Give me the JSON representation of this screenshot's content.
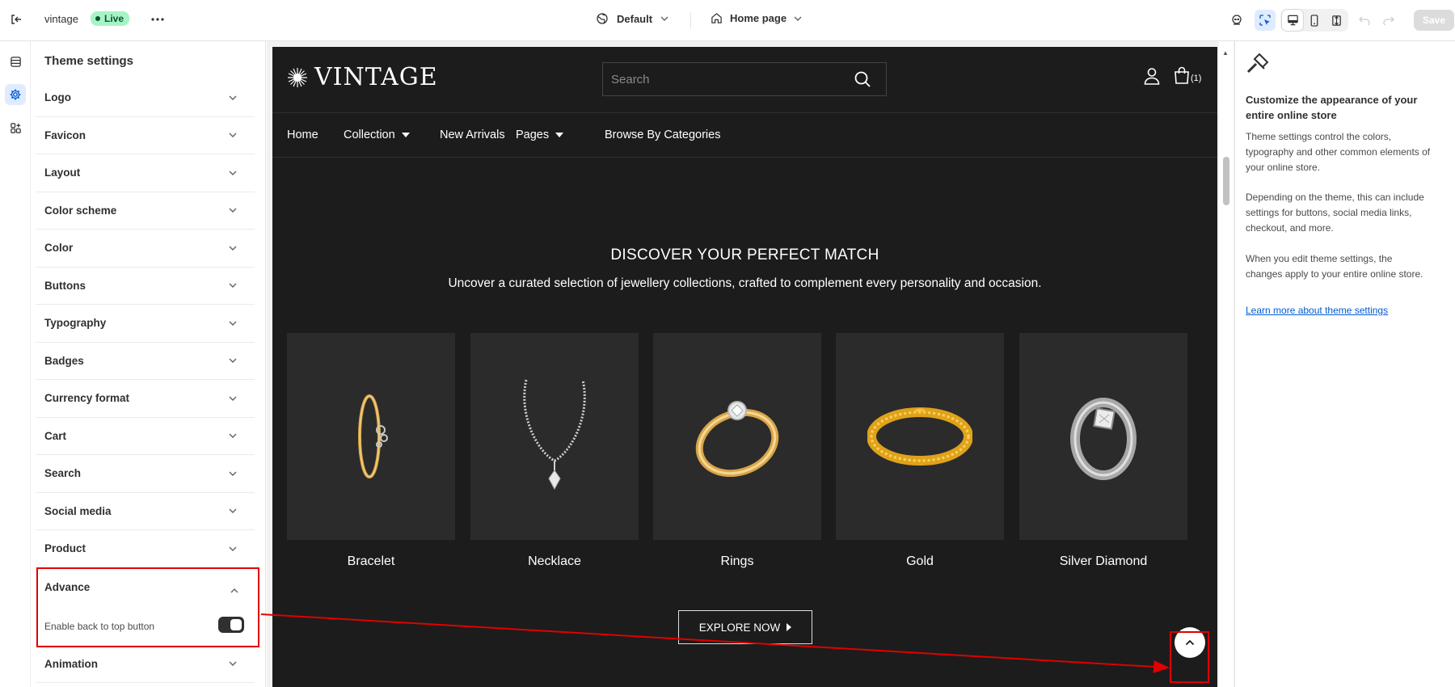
{
  "topbar": {
    "store_name": "vintage",
    "status_badge": "Live",
    "theme_selector": "Default",
    "page_selector": "Home page",
    "save_label": "Save"
  },
  "settings_panel": {
    "title": "Theme settings",
    "sections_before": [
      "Logo",
      "Favicon",
      "Layout",
      "Color scheme",
      "Color",
      "Buttons",
      "Typography",
      "Badges",
      "Currency format",
      "Cart",
      "Search",
      "Social media",
      "Product"
    ],
    "advance": {
      "label": "Advance",
      "option_label": "Enable back to top button",
      "option_enabled": true
    },
    "sections_after": [
      "Animation"
    ]
  },
  "store": {
    "logo_text": "VINTAGE",
    "search_placeholder": "Search",
    "cart_count": "(1)",
    "nav": [
      {
        "label": "Home",
        "dropdown": false
      },
      {
        "label": "Collection",
        "dropdown": true
      },
      {
        "label": "New Arrivals",
        "dropdown": false
      },
      {
        "label": "Pages",
        "dropdown": true
      },
      {
        "label": "Browse By Categories",
        "dropdown": false
      }
    ],
    "hero_title": "DISCOVER YOUR PERFECT MATCH",
    "hero_subtitle": "Uncover a curated selection of jewellery collections, crafted to complement every personality and occasion.",
    "categories": [
      "Bracelet",
      "Necklace",
      "Rings",
      "Gold",
      "Silver Diamond"
    ],
    "cta_label": "EXPLORE NOW"
  },
  "help_panel": {
    "title": "Customize the appearance of your entire online store",
    "paragraphs": [
      "Theme settings control the colors, typography and other common elements of your online store.",
      "Depending on the theme, this can include settings for buttons, social media links, checkout, and more.",
      "When you edit theme settings, the changes apply to your entire online store."
    ],
    "link_label": "Learn more about theme settings"
  },
  "colors": {
    "annotation_red": "#e00000",
    "store_bg": "#1c1c1c",
    "card_bg": "#2b2b2b",
    "live_badge_bg": "#a7f3c5",
    "link_blue": "#005bd3"
  }
}
